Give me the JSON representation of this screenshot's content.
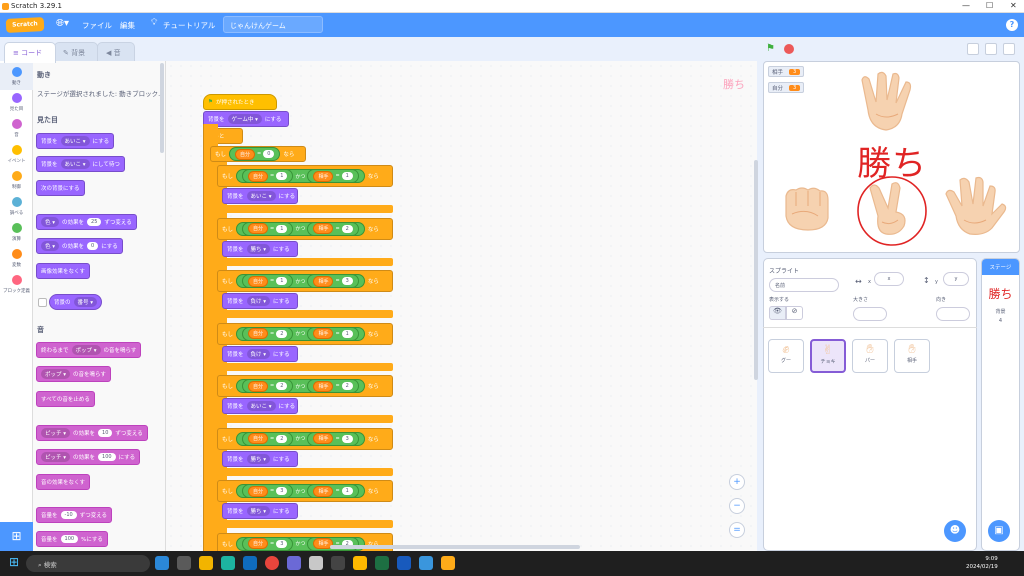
{
  "window": {
    "title": "Scratch 3.29.1"
  },
  "menubar": {
    "logo": "Scratch",
    "file": "ファイル",
    "edit": "編集",
    "tutorial": "チュートリアル",
    "project_name": "じゃんけんゲーム",
    "help": "?"
  },
  "tabs": {
    "code": "コード",
    "costumes": "背景",
    "sounds": "音"
  },
  "categories": [
    {
      "label": "動き",
      "color": "#4c97ff"
    },
    {
      "label": "見た目",
      "color": "#9966ff"
    },
    {
      "label": "音",
      "color": "#cf63cf"
    },
    {
      "label": "イベント",
      "color": "#ffbf00"
    },
    {
      "label": "制御",
      "color": "#ffab19"
    },
    {
      "label": "調べる",
      "color": "#5cb1d6"
    },
    {
      "label": "演算",
      "color": "#59c059"
    },
    {
      "label": "変数",
      "color": "#ff8c1a"
    },
    {
      "label": "ブロック定義",
      "color": "#ff6680"
    }
  ],
  "palette": {
    "motion_head": "動き",
    "motion_note": "ステージが選択されました: 動きブロック...",
    "looks_head": "見た目",
    "b1a": "背景を",
    "b1b": "あいこ ▾",
    "b1c": "にする",
    "b2a": "背景を",
    "b2b": "あいこ ▾",
    "b2c": "にして待つ",
    "b3": "次の背景にする",
    "b4a": "色 ▾",
    "b4b": "の効果を",
    "b4c": "25",
    "b4d": "ずつ変える",
    "b5a": "色 ▾",
    "b5b": "の効果を",
    "b5c": "0",
    "b5d": "にする",
    "b6": "画像効果をなくす",
    "b7a": "背景の",
    "b7b": "番号 ▾",
    "sound_head": "音",
    "s1a": "終わるまで",
    "s1b": "ポップ ▾",
    "s1c": "の音を鳴らす",
    "s2a": "ポップ ▾",
    "s2b": "の音を鳴らす",
    "s3": "すべての音を止める",
    "s4a": "ピッチ ▾",
    "s4b": "の効果を",
    "s4c": "10",
    "s4d": "ずつ変える",
    "s5a": "ピッチ ▾",
    "s5b": "の効果を",
    "s5c": "100",
    "s5d": "にする",
    "s6": "音の効果をなくす",
    "s7a": "音量を",
    "s7b": "-10",
    "s7c": "ずつ変える",
    "s8a": "音量を",
    "s8b": "100",
    "s8c": "%にする"
  },
  "script": {
    "watermark": "勝ち",
    "hat": "が押されたとき",
    "set1a": "背景を",
    "set1b": "ゲーム中 ▾",
    "set1c": "にする",
    "forever": "ずっと",
    "if_kw": "もし",
    "then_kw": "なら",
    "and_kw": "かつ",
    "eq": "=",
    "set": "背景を",
    "to": "にする",
    "outer": {
      "var": "自分",
      "val": "0"
    },
    "rows": [
      {
        "a": "自分",
        "av": "1",
        "b": "相手",
        "bv": "1",
        "res": "あいこ ▾"
      },
      {
        "a": "自分",
        "av": "1",
        "b": "相手",
        "bv": "2",
        "res": "勝ち ▾"
      },
      {
        "a": "自分",
        "av": "1",
        "b": "相手",
        "bv": "3",
        "res": "負け ▾"
      },
      {
        "a": "自分",
        "av": "2",
        "b": "相手",
        "bv": "1",
        "res": "負け ▾"
      },
      {
        "a": "自分",
        "av": "2",
        "b": "相手",
        "bv": "2",
        "res": "あいこ ▾"
      },
      {
        "a": "自分",
        "av": "2",
        "b": "相手",
        "bv": "3",
        "res": "勝ち ▾"
      },
      {
        "a": "自分",
        "av": "3",
        "b": "相手",
        "bv": "1",
        "res": "勝ち ▾"
      },
      {
        "a": "自分",
        "av": "3",
        "b": "相手",
        "bv": "2",
        "res": ""
      }
    ],
    "zoom_in": "+",
    "zoom_out": "−",
    "zoom_reset": "="
  },
  "stage": {
    "mon1_name": "相手",
    "mon1_val": "3",
    "mon2_name": "自分",
    "mon2_val": "3",
    "big_text": "勝ち"
  },
  "sprite_info": {
    "sprite_label": "スプライト",
    "name_placeholder": "名前",
    "x_label": "x",
    "x_val": "x",
    "y_label": "y",
    "y_val": "y",
    "show_label": "表示する",
    "size_label": "大きさ",
    "dir_label": "向き"
  },
  "sprites": [
    {
      "name": "グー"
    },
    {
      "name": "チョキ"
    },
    {
      "name": "パー"
    },
    {
      "name": "相手"
    }
  ],
  "stage_col": {
    "header": "ステージ",
    "thumb_text": "勝ち",
    "bg_label": "背景",
    "bg_count": "4"
  },
  "taskbar": {
    "search": "検索",
    "time": "9:09",
    "date": "2024/02/19"
  }
}
